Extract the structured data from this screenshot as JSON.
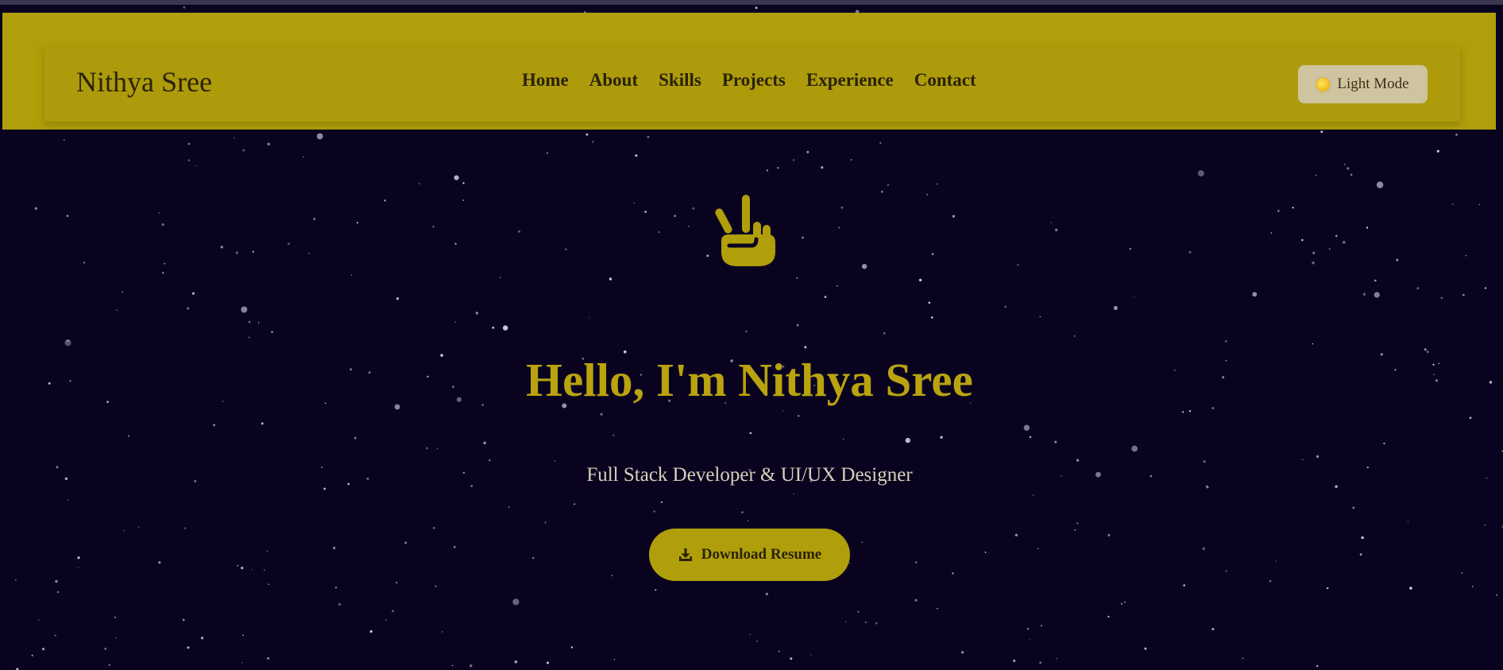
{
  "theme": {
    "background": "#0a0320",
    "accent": "#b09e0a",
    "header_band": "#b09e0a",
    "hero_title_color": "#b9a30f",
    "subtitle_color": "#d7d0b8"
  },
  "navbar": {
    "brand": "Nithya Sree",
    "links": [
      "Home",
      "About",
      "Skills",
      "Projects",
      "Experience",
      "Contact"
    ],
    "mode_toggle": {
      "icon": "sun-icon",
      "label": "Light Mode"
    }
  },
  "hero": {
    "icon": "peace-hand-icon",
    "title": "Hello, I'm Nithya Sree",
    "subtitle": "Full Stack Developer & UI/UX Designer",
    "cta": {
      "icon": "download-icon",
      "label": "Download Resume"
    }
  }
}
